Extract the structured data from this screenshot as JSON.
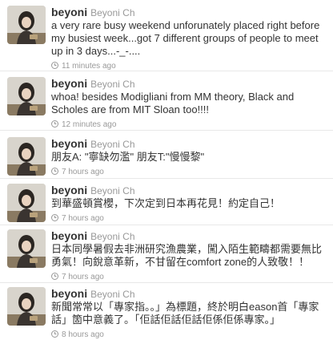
{
  "tweets": [
    {
      "screen_name": "beyoni",
      "full_name": "Beyoni Ch",
      "text": "a very rare busy weekend unforunately placed right before my busiest week...got 7 different groups of people to meet up in 3 days...-_-....",
      "time": "11 minutes ago"
    },
    {
      "screen_name": "beyoni",
      "full_name": "Beyoni Ch",
      "text": "whoa! besides Modigliani from MM theory, Black and Scholes are from MIT Sloan too!!!!",
      "time": "12 minutes ago"
    },
    {
      "screen_name": "beyoni",
      "full_name": "Beyoni Ch",
      "text": "朋友A: \"寧缺勿濫\" 朋友T:\"慢慢黎\"",
      "time": "7 hours ago"
    },
    {
      "screen_name": "beyoni",
      "full_name": "Beyoni Ch",
      "text": "到華盛頓賞櫻，下次定到日本再花見！約定自己！",
      "time": "7 hours ago"
    },
    {
      "screen_name": "beyoni",
      "full_name": "Beyoni Ch",
      "text": "日本同學暑假去非洲研究漁農業，闖入陌生範疇都需要無比勇氣！向銳意革新，不甘留在comfort zone的人致敬！！",
      "time": "7 hours ago"
    },
    {
      "screen_name": "beyoni",
      "full_name": "Beyoni Ch",
      "text": "新聞常常以「專家指。。」為標題，終於明白eason首「專家話」箇中意義了。「佢話佢話佢話佢係佢係專家。」",
      "time": "8 hours ago"
    }
  ]
}
